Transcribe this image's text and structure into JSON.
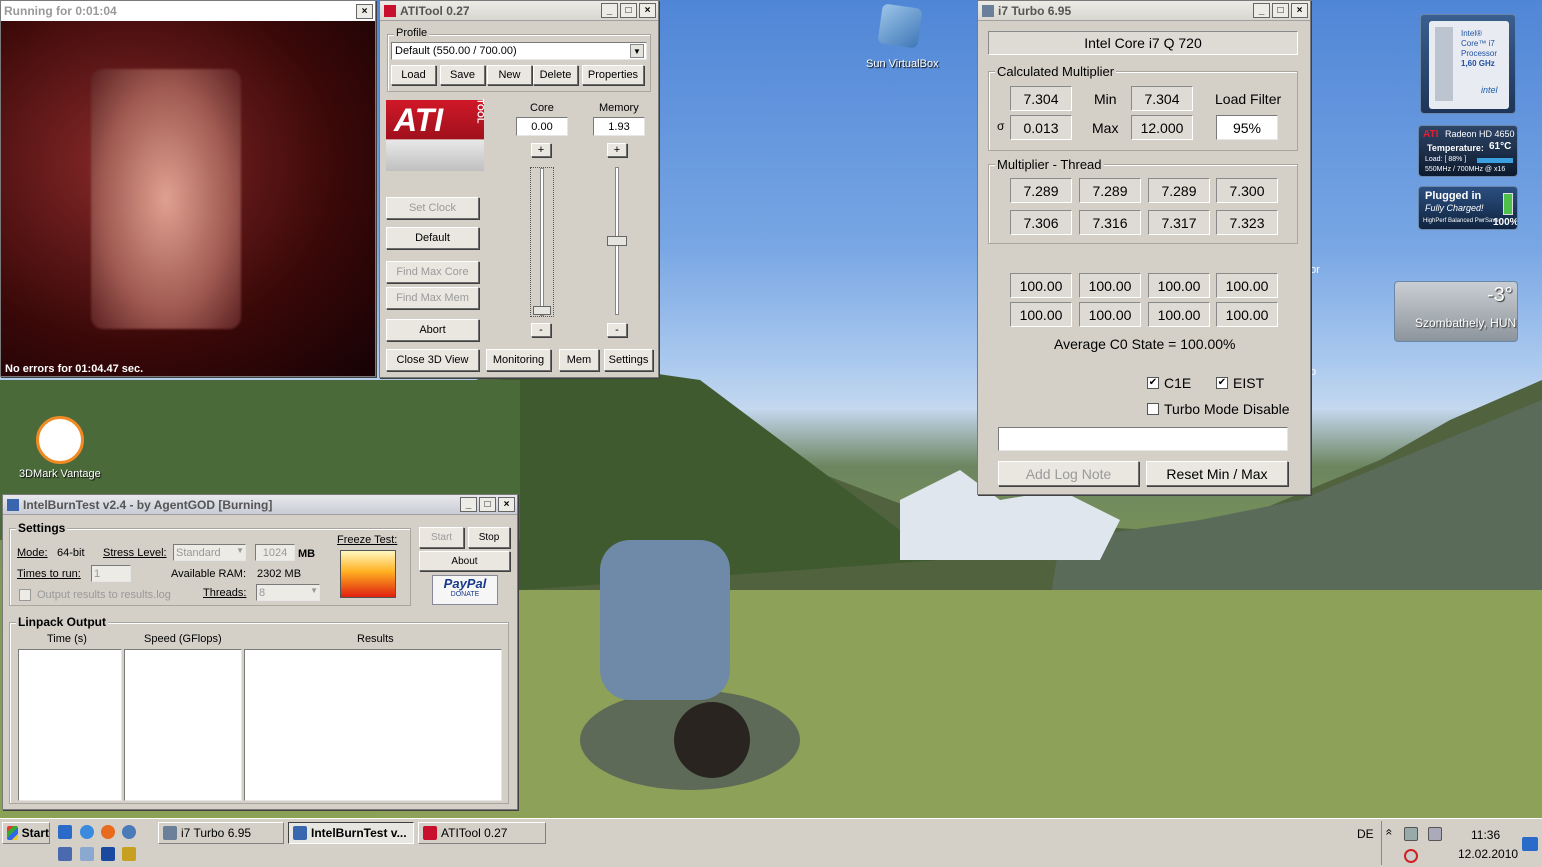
{
  "colors": {
    "sky": "#5b8fd9",
    "grass": "#7f9a54",
    "window_face": "#d4d0c8",
    "ati_red": "#c8102e"
  },
  "render_window": {
    "title": "Running for 0:01:04",
    "status": "No errors for 01:04.47 sec.",
    "close": "×"
  },
  "atitool": {
    "title": "ATITool 0.27",
    "profile_label": "Profile",
    "profile_value": "Default (550.00 / 700.00)",
    "buttons": {
      "load": "Load",
      "save": "Save",
      "new": "New",
      "delete": "Delete",
      "properties": "Properties",
      "set_clock": "Set Clock",
      "default": "Default",
      "find_max_core": "Find Max Core",
      "find_max_mem": "Find Max Mem",
      "abort": "Abort",
      "close_3d": "Close 3D View",
      "monitoring": "Monitoring",
      "mem": "Mem",
      "settings": "Settings"
    },
    "logo": "ATI",
    "logo_sub": "TOOL",
    "core_label": "Core",
    "core_value": "0.00",
    "memory_label": "Memory",
    "memory_value": "1.93",
    "plus": "+",
    "minus": "-"
  },
  "i7turbo": {
    "title": "i7 Turbo 6.95",
    "cpu": "Intel Core i7 Q 720",
    "calc_label": "Calculated Multiplier",
    "mult": "7.304",
    "min_label": "Min",
    "min": "7.304",
    "load_filter_label": "Load Filter",
    "sigma_symbol": "σ",
    "sigma": "0.013",
    "max_label": "Max",
    "max": "12.000",
    "load_filter": "95%",
    "thread_label": "Multiplier - Thread",
    "threads": [
      "7.289",
      "7.289",
      "7.289",
      "7.300",
      "7.306",
      "7.316",
      "7.317",
      "7.323"
    ],
    "c0": [
      "100.00",
      "100.00",
      "100.00",
      "100.00",
      "100.00",
      "100.00",
      "100.00",
      "100.00"
    ],
    "avg": "Average C0 State = 100.00%",
    "c1e": "C1E",
    "eist": "EIST",
    "turbo_disable": "Turbo Mode Disable",
    "check": "✔",
    "add_log": "Add Log Note",
    "reset": "Reset Min / Max"
  },
  "ibt": {
    "title": "IntelBurnTest v2.4 - by AgentGOD [Burning]",
    "settings_label": "Settings",
    "mode_label": "Mode:",
    "mode": "64-bit",
    "stress_label": "Stress Level:",
    "stress": "Standard",
    "mem_value": "1024",
    "mem_unit": "MB",
    "times_label": "Times to run:",
    "times": "1",
    "ram_label": "Available RAM:",
    "ram": "2302 MB",
    "output_label": "Output results to results.log",
    "threads_label": "Threads:",
    "threads": "8",
    "freeze_label": "Freeze Test:",
    "start": "Start",
    "stop": "Stop",
    "about": "About",
    "paypal": "PayPal",
    "donate": "DONATE",
    "linpack_label": "Linpack Output",
    "cols": [
      "Time (s)",
      "Speed (GFlops)",
      "Results"
    ]
  },
  "desktop_icons": {
    "vbox": "Sun VirtualBox",
    "vantage": "3DMark Vantage"
  },
  "gadgets": {
    "intel_line1": "Intel®",
    "intel_line2": "Core™ i7",
    "intel_line3": "Processor",
    "intel_line4": "1,60 GHz",
    "intel_brand": "intel",
    "ati_name": "Radeon HD 4650",
    "ati_temp_label": "Temperature:",
    "ati_temp": "61°C",
    "ati_load": "Load: [ 88% ]",
    "ati_clock": "550MHz / 700MHz @ x16",
    "battery_line1": "Plugged in",
    "battery_line2": "Fully Charged!",
    "battery_line3": "HighPerf Balanced PwrSave",
    "battery_pct": "100%",
    "weather_temp": "-3°",
    "weather_city": "Szombathely, HUN",
    "edge_a": "or",
    "edge_b": "o"
  },
  "taskbar": {
    "start": "Start",
    "tasks": [
      "i7 Turbo 6.95",
      "IntelBurnTest v...",
      "ATITool 0.27"
    ],
    "lang": "DE",
    "time": "11:36",
    "date": "12.02.2010",
    "tray_arrow": "«"
  }
}
